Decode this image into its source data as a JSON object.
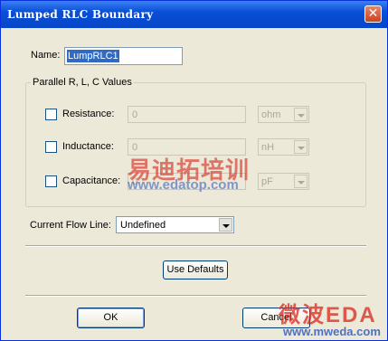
{
  "dialog": {
    "title": "Lumped RLC Boundary",
    "close_glyph": "✕"
  },
  "name_field": {
    "label": "Name:",
    "value": "LumpRLC1"
  },
  "parallel_group": {
    "caption": "Parallel R, L, C Values",
    "rows": [
      {
        "label": "Resistance:",
        "value": "0",
        "unit": "ohm",
        "checked": false
      },
      {
        "label": "Inductance:",
        "value": "0",
        "unit": "nH",
        "checked": false
      },
      {
        "label": "Capacitance:",
        "value": "0",
        "unit": "pF",
        "checked": false
      }
    ]
  },
  "flow_line": {
    "label": "Current Flow Line:",
    "value": "Undefined"
  },
  "buttons": {
    "use_defaults": "Use Defaults",
    "ok": "OK",
    "cancel": "Cancel"
  },
  "watermarks": {
    "cn_top": "易迪拓培训",
    "url_top": "www.edatop.com",
    "cn_bottom": "微波EDA",
    "url_bottom": "www.mweda.com"
  },
  "icons": {
    "close": "close-icon",
    "dropdown": "chevron-down-icon"
  },
  "colors": {
    "titlebar": "#0a4fd6",
    "selection": "#316ac5",
    "watermark_red": "#d9251c"
  }
}
